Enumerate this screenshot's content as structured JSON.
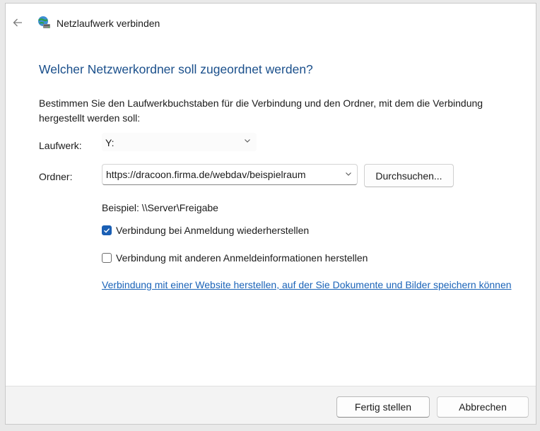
{
  "window": {
    "title": "Netzlaufwerk verbinden"
  },
  "main": {
    "heading": "Welcher Netzwerkordner soll zugeordnet werden?",
    "description": "Bestimmen Sie den Laufwerkbuchstaben für die Verbindung und den Ordner, mit dem die Verbindung hergestellt werden soll:",
    "drive_label": "Laufwerk:",
    "drive_value": "Y:",
    "folder_label": "Ordner:",
    "folder_value": "https://dracoon.firma.de/webdav/beispielraum",
    "browse_label": "Durchsuchen...",
    "example": "Beispiel: \\\\Server\\Freigabe",
    "reconnect_label": "Verbindung bei Anmeldung wiederherstellen",
    "reconnect_checked": true,
    "other_credentials_label": "Verbindung mit anderen Anmeldeinformationen herstellen",
    "other_credentials_checked": false,
    "website_link": "Verbindung mit einer Website herstellen, auf der Sie Dokumente und Bilder speichern können"
  },
  "footer": {
    "finish_label": "Fertig stellen",
    "cancel_label": "Abbrechen"
  },
  "icons": {
    "back": "arrow-left-icon",
    "app": "network-drive-icon",
    "chevron": "chevron-down-icon",
    "check": "checkmark-icon"
  },
  "colors": {
    "heading": "#1a4f8b",
    "accent": "#1a5fb4",
    "link": "#1a63b8",
    "footer_bg": "#f3f3f3"
  }
}
